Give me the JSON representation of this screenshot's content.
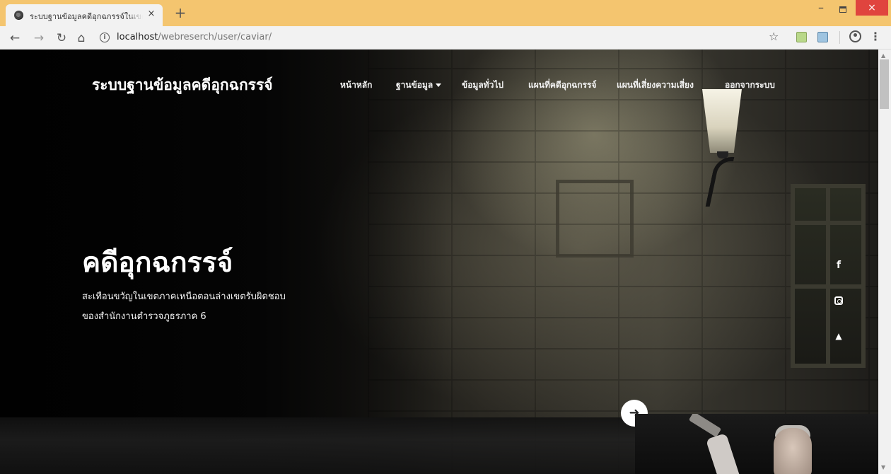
{
  "browser": {
    "tab_title": "ระบบฐานข้อมูลคดีอุกฉกรรจ์ในเขตภาค",
    "tab_close": "×",
    "new_tab": "+",
    "url_host": "localhost",
    "url_path": "/webreserch/user/caviar/",
    "nav_icons": [
      "back-arrow-icon",
      "forward-arrow-icon",
      "reload-icon",
      "home-icon"
    ],
    "window_close": "×",
    "window_minimize": "–"
  },
  "site": {
    "brand": "ระบบฐานข้อมูลคดีอุกฉกรรจ์",
    "nav": [
      {
        "label": "หน้าหลัก"
      },
      {
        "label": "ฐานข้อมูล",
        "has_dropdown": true
      },
      {
        "label": "ข้อมูลทั่วไป"
      },
      {
        "label": "แผนที่คดีอุกฉกรรจ์"
      },
      {
        "label": "แผนที่เสี่ยงความเสี่ยง"
      },
      {
        "label": "ออกจากระบบ"
      }
    ]
  },
  "hero": {
    "title": "คดีอุกฉกรรจ์",
    "subtitle_line1": "สะเทือนขวัญในเขตภาคเหนือตอนล่างเขตรับผิดชอบ",
    "subtitle_line2": "ของสำนักงานตำรวจภูธรภาค 6"
  },
  "social": {
    "facebook": "f",
    "twitter": "🐦"
  },
  "colors": {
    "tabstrip": "#f4c56f",
    "window_close": "#e0443e",
    "hero_text": "#ffffff"
  }
}
